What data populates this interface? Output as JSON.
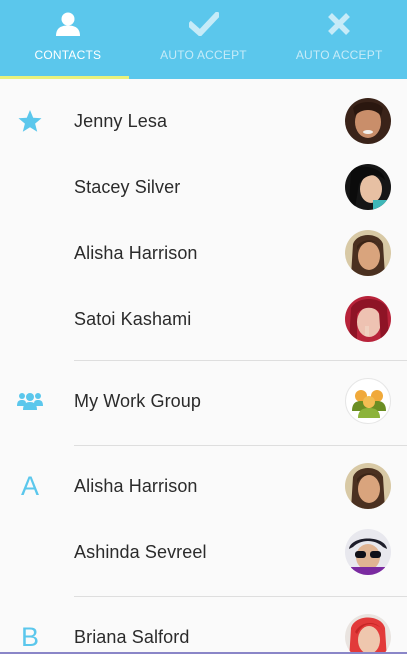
{
  "tabs": [
    {
      "label": "CONTACTS",
      "icon": "person-icon",
      "active": true
    },
    {
      "label": "AUTO ACCEPT",
      "icon": "checkmark-icon",
      "active": false
    },
    {
      "label": "AUTO ACCEPT",
      "icon": "x-icon",
      "active": false
    }
  ],
  "colors": {
    "accent": "#5bc7ec",
    "tab_indicator": "#e9f27c",
    "background": "#fafafa",
    "text": "#2b2b2b"
  },
  "sections": {
    "favorites": {
      "icon": "star-icon",
      "contacts": [
        "Jenny Lesa",
        "Stacey Silver",
        "Alisha Harrison",
        "Satoi Kashami"
      ]
    },
    "groups": {
      "icon": "group-icon",
      "contacts": [
        "My Work Group"
      ]
    },
    "a": {
      "letter": "A",
      "contacts": [
        "Alisha Harrison",
        "Ashinda Sevreel"
      ]
    },
    "b": {
      "letter": "B",
      "contacts": [
        "Briana Salford"
      ]
    }
  }
}
